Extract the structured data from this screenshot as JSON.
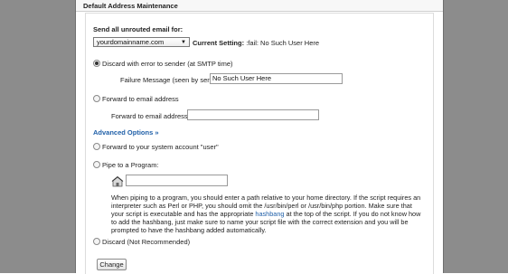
{
  "header": {
    "title": "Default Address Maintenance"
  },
  "form": {
    "send_all_label": "Send all unrouted email for:",
    "domain_select_value": "yourdomainname.com",
    "current_setting_label": "Current Setting",
    "current_setting_value": ":fail: No Such User Here",
    "options": {
      "discard_error": {
        "label": "Discard with error to sender (at SMTP time)",
        "checked": true,
        "failure_label": "Failure Message (seen by sender):",
        "failure_value": "No Such User Here"
      },
      "forward_email": {
        "label": "Forward to email address",
        "checked": false,
        "address_label": "Forward to email address:",
        "address_value": ""
      },
      "advanced_label": "Advanced Options »",
      "forward_system": {
        "label": "Forward to your system account \"user\"",
        "checked": false
      },
      "pipe": {
        "label": "Pipe to a Program:",
        "checked": false,
        "path_value": "",
        "help_prefix": "When piping to a program, you should enter a path relative to your home directory. If the script requires an interpreter such as Perl or PHP, you should omit the /usr/bin/perl or /usr/bin/php portion. Make sure that your script is executable and has the appropriate ",
        "help_link": "hashbang",
        "help_suffix": " at the top of the script. If you do not know how to add the hashbang, just make sure to name your script file with the correct extension and you will be prompted to have the hashbang added automatically."
      },
      "discard": {
        "label": "Discard (Not Recommended)",
        "checked": false
      }
    },
    "change_button": "Change"
  },
  "icons": {
    "home": "home-folder-icon"
  }
}
